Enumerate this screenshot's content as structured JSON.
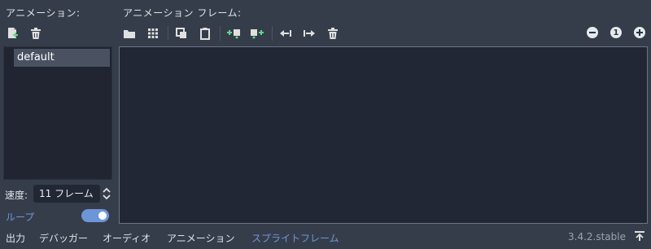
{
  "panel": {
    "animations_header": "アニメーション:",
    "frames_header": "アニメーション フレーム:"
  },
  "animations": {
    "items": [
      "default"
    ],
    "toolbar": [
      {
        "icon": "new-animation-icon"
      },
      {
        "icon": "delete-animation-icon"
      }
    ]
  },
  "frames_toolbar": [
    {
      "icon": "load-frames-folder-icon"
    },
    {
      "icon": "load-from-spritesheet-grid-icon"
    },
    {
      "icon": "copy-icon"
    },
    {
      "icon": "paste-icon"
    },
    {
      "icon": "insert-empty-before-icon"
    },
    {
      "icon": "insert-empty-after-icon"
    },
    {
      "icon": "move-left-icon"
    },
    {
      "icon": "move-right-icon"
    },
    {
      "icon": "delete-frame-icon"
    }
  ],
  "zoom": {
    "out_icon": "zoom-out-icon",
    "reset_label": "1",
    "in_icon": "zoom-in-icon"
  },
  "speed": {
    "label": "速度:",
    "value": "11 フレーム"
  },
  "loop": {
    "label": "ループ",
    "enabled": true,
    "accent": "#6d96d8"
  },
  "bottom_tabs": [
    {
      "label": "出力",
      "active": false
    },
    {
      "label": "デバッガー",
      "active": false
    },
    {
      "label": "オーディオ",
      "active": false
    },
    {
      "label": "アニメーション",
      "active": false
    },
    {
      "label": "スプライトフレーム",
      "active": true
    }
  ],
  "version": "3.4.2.stable",
  "colors": {
    "background": "#363d4a",
    "panel": "#222735",
    "accent": "#6d96d8"
  }
}
